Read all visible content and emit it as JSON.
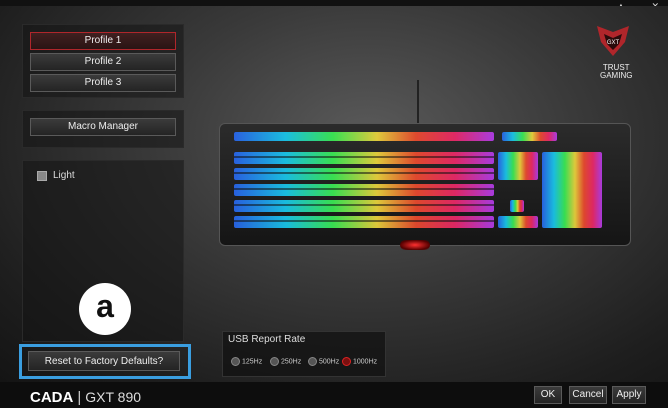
{
  "window": {
    "controls": "▲ — ✕"
  },
  "profiles": [
    "Profile 1",
    "Profile 2",
    "Profile 3"
  ],
  "macro_button": "Macro Manager",
  "light_label": "Light",
  "reset_button": "Reset to Factory Defaults?",
  "logo_letter": "a",
  "brand": {
    "name": "CADA",
    "separator": "|",
    "model": "GXT 890"
  },
  "usb": {
    "title": "USB Report Rate",
    "options": [
      "125Hz",
      "250Hz",
      "500Hz",
      "1000Hz"
    ],
    "selected": "1000Hz"
  },
  "gxt_logo": {
    "badge": "GXT",
    "line1": "TRUST",
    "line2": "GAMING"
  },
  "actions": {
    "ok": "OK",
    "cancel": "Cancel",
    "apply": "Apply"
  },
  "colors": {
    "accent_red": "#b0262b",
    "highlight_blue": "#3a9ee0"
  }
}
